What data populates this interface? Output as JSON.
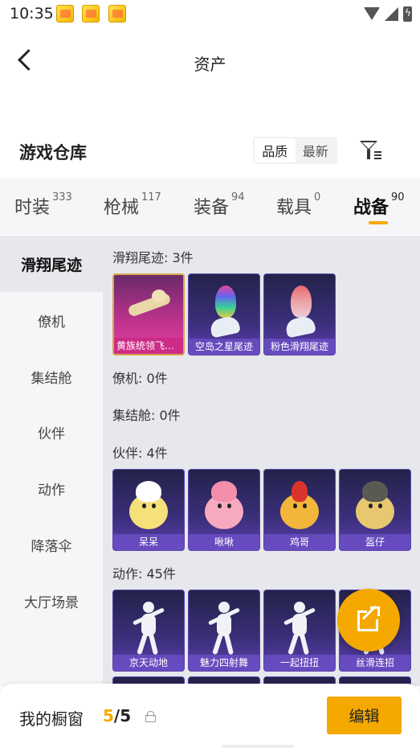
{
  "status_bar": {
    "time": "10:35",
    "notification_icons": [
      "game-app-icon",
      "game-app-icon",
      "game-app-icon"
    ],
    "system_icons": [
      "wifi-icon",
      "signal-icon",
      "battery-charging-icon"
    ]
  },
  "header": {
    "title": "资产",
    "back_icon": "back-arrow-icon"
  },
  "warehouse": {
    "title": "游戏仓库",
    "sort_options": [
      "品质",
      "最新"
    ],
    "sort_selected": "品质",
    "filter_icon": "filter-icon"
  },
  "tabs": [
    {
      "label": "时装",
      "count": "333"
    },
    {
      "label": "枪械",
      "count": "117"
    },
    {
      "label": "装备",
      "count": "94"
    },
    {
      "label": "载具",
      "count": "0"
    },
    {
      "label": "战备",
      "count": "90",
      "active": true
    }
  ],
  "sidebar": {
    "items": [
      "滑翔尾迹",
      "僚机",
      "集结舱",
      "伙伴",
      "动作",
      "降落伞",
      "大厅场景"
    ],
    "active": "滑翔尾迹"
  },
  "groups": {
    "glide_trail": {
      "name": "滑翔尾迹",
      "count": "3件",
      "items": [
        "黄族统领飞行...",
        "空岛之星尾迹",
        "粉色滑翔尾迹"
      ]
    },
    "wingman": {
      "name": "僚机",
      "count": "0件"
    },
    "assembly_pod": {
      "name": "集结舱",
      "count": "0件"
    },
    "partner": {
      "name": "伙伴",
      "count": "4件",
      "items": [
        "呆呆",
        "啾啾",
        "鸡哥",
        "盔仔"
      ]
    },
    "emote": {
      "name": "动作",
      "count": "45件",
      "items": [
        "京天动地",
        "魅力四射舞",
        "一起扭扭",
        "丝滑连招"
      ]
    }
  },
  "colors": {
    "accent": "#f5a800",
    "card_purple": "#3b2f7a",
    "card_pink": "#c0338f"
  },
  "bottom_bar": {
    "label": "我的橱窗",
    "count_current": "5",
    "count_separator": "/",
    "count_total": "5",
    "lock_icon": "lock-icon",
    "edit_label": "编辑"
  },
  "share_fab_icon": "share-external-icon"
}
